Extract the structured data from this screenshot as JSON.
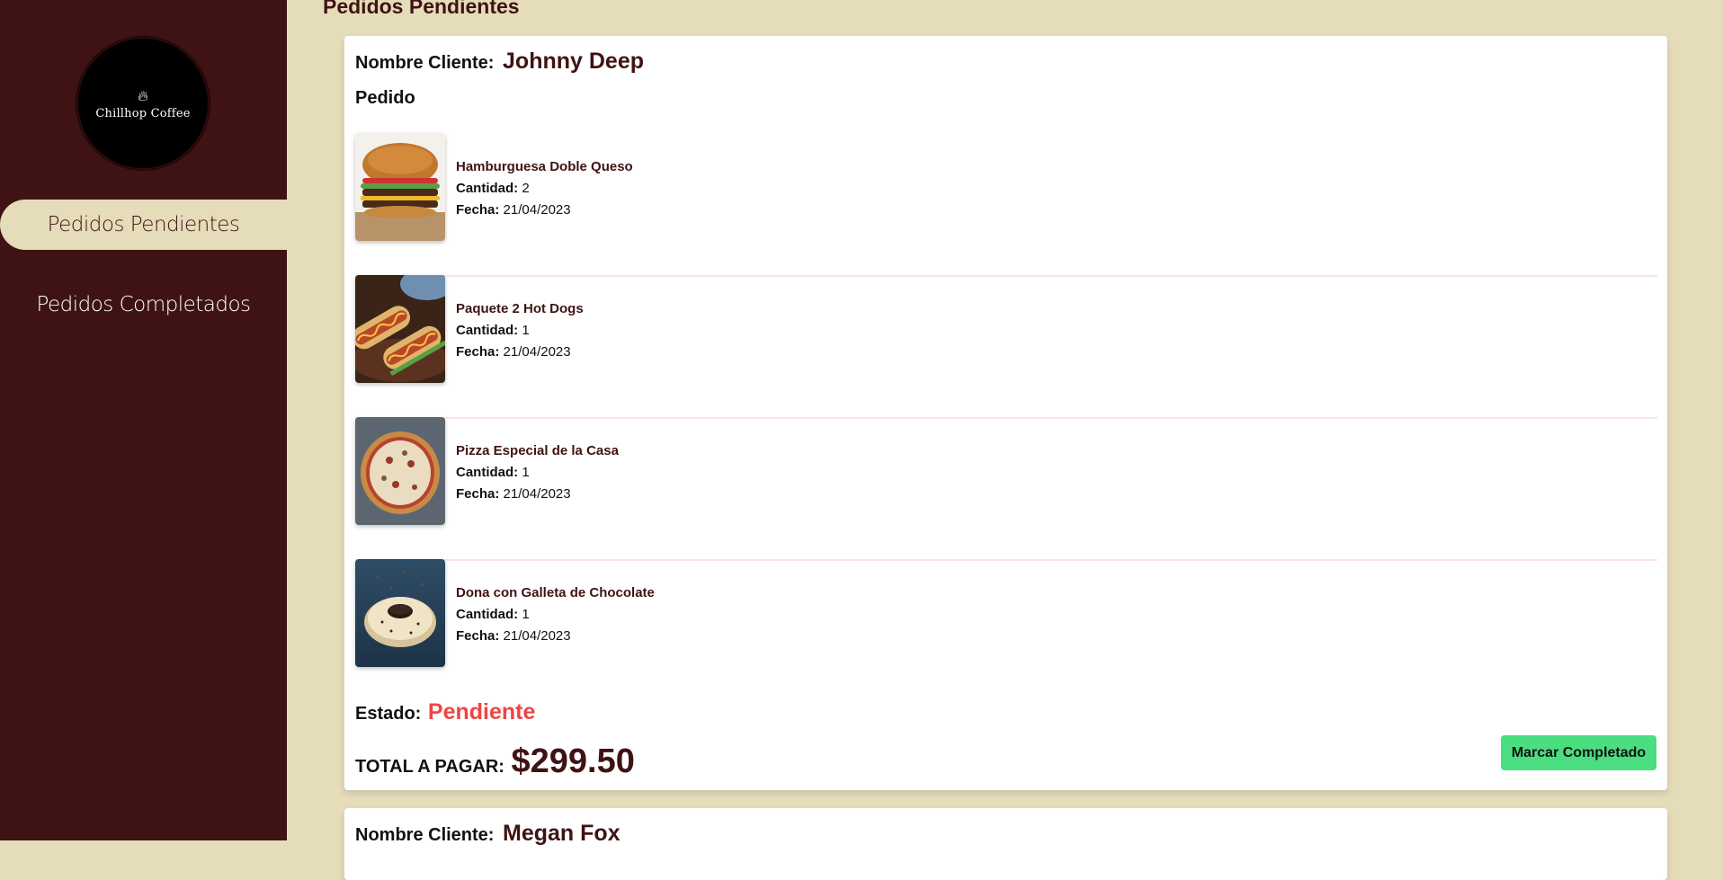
{
  "sidebar": {
    "logo_text": "Chillhop Coffee",
    "nav": [
      {
        "label": "Pedidos Pendientes",
        "active": true
      },
      {
        "label": "Pedidos Completados",
        "active": false
      }
    ]
  },
  "page": {
    "title": "Pedidos Pendientes"
  },
  "labels": {
    "cliente": "Nombre Cliente:",
    "pedido": "Pedido",
    "cantidad": "Cantidad:",
    "fecha": "Fecha:",
    "estado": "Estado:",
    "total": "TOTAL A PAGAR:",
    "mark_button": "Marcar Completado"
  },
  "orders": [
    {
      "client": "Johnny Deep",
      "items": [
        {
          "name": "Hamburguesa Doble Queso",
          "quantity": "2",
          "date": "21/04/2023",
          "image_icon": "burger-image"
        },
        {
          "name": "Paquete 2 Hot Dogs",
          "quantity": "1",
          "date": "21/04/2023",
          "image_icon": "hotdog-image"
        },
        {
          "name": "Pizza Especial de la Casa",
          "quantity": "1",
          "date": "21/04/2023",
          "image_icon": "pizza-image"
        },
        {
          "name": "Dona con Galleta de Chocolate",
          "quantity": "1",
          "date": "21/04/2023",
          "image_icon": "donut-image"
        }
      ],
      "status": "Pendiente",
      "total": "$299.50"
    },
    {
      "client": "Megan Fox"
    }
  ],
  "colors": {
    "sidebar_bg": "#3f1313",
    "page_bg": "#e5dcba",
    "accent": "#3f1313",
    "status_pending": "#ef4444",
    "button_green": "#4ade80"
  }
}
